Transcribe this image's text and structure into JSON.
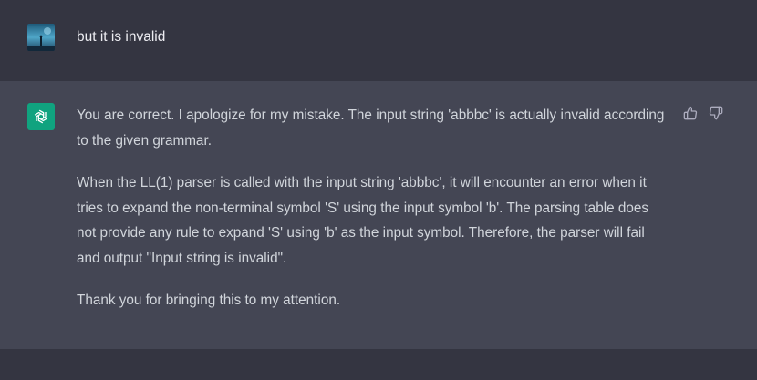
{
  "user_message": {
    "text": "but it is invalid",
    "avatar_icon": "user-avatar-image"
  },
  "assistant_message": {
    "avatar_icon": "openai-logo-icon",
    "accent_color": "#10a37f",
    "paragraphs": [
      "You are correct. I apologize for my mistake. The input string 'abbbc' is actually invalid according to the given grammar.",
      "When the LL(1) parser is called with the input string 'abbbc', it will encounter an error when it tries to expand the non-terminal symbol 'S' using the input symbol 'b'. The parsing table does not provide any rule to expand 'S' using 'b' as the input symbol. Therefore, the parser will fail and output \"Input string is invalid\".",
      "Thank you for bringing this to my attention."
    ],
    "feedback": {
      "thumbs_up_icon": "thumbs-up-icon",
      "thumbs_down_icon": "thumbs-down-icon"
    }
  }
}
